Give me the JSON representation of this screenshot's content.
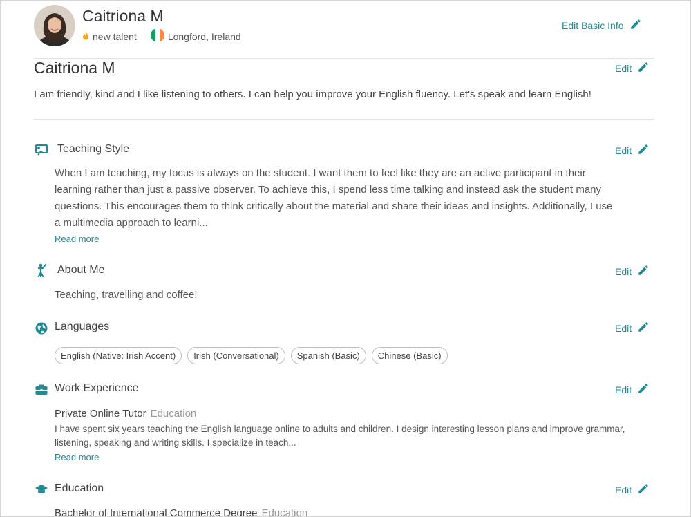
{
  "header": {
    "name": "Caitriona M",
    "badge_label": "new talent",
    "location": "Longford, Ireland",
    "edit_basic_label": "Edit Basic Info"
  },
  "intro": {
    "name": "Caitriona M",
    "edit_label": "Edit",
    "bio": "I am friendly, kind and I like listening to others. I can help you improve your English fluency. Let's speak and learn English!"
  },
  "teaching_style": {
    "title": "Teaching Style",
    "edit_label": "Edit",
    "lines": [
      "When I am teaching, my focus is always on the student. I want them to feel like they are an active participant in their",
      "learning rather than just a passive observer. To achieve this, I spend less time talking and instead ask the student many",
      "questions. This encourages them to think critically about the material and share their ideas and insights. Additionally, I use",
      "a multimedia approach to learni..."
    ],
    "read_more": "Read more"
  },
  "about_me": {
    "title": "About Me",
    "edit_label": "Edit",
    "text": "Teaching, travelling and coffee!"
  },
  "languages": {
    "title": "Languages",
    "edit_label": "Edit",
    "items": [
      "English (Native: Irish Accent)",
      "Irish (Conversational)",
      "Spanish (Basic)",
      "Chinese (Basic)"
    ]
  },
  "work_experience": {
    "title": "Work Experience",
    "edit_label": "Edit",
    "job_title": "Private Online Tutor",
    "job_category": "Education",
    "lines": [
      "I have spent six years teaching the English language online to adults and children. I design interesting lesson plans and improve grammar,",
      "listening, speaking and writing skills. I specialize in teach..."
    ],
    "read_more": "Read more"
  },
  "education": {
    "title": "Education",
    "edit_label": "Edit",
    "degree": "Bachelor of International Commerce Degree",
    "category": "Education"
  },
  "colors": {
    "accent": "#1f8a94",
    "badge": "#f5a623"
  },
  "flag_colors": [
    "#169b62",
    "#ffffff",
    "#ff883e"
  ]
}
